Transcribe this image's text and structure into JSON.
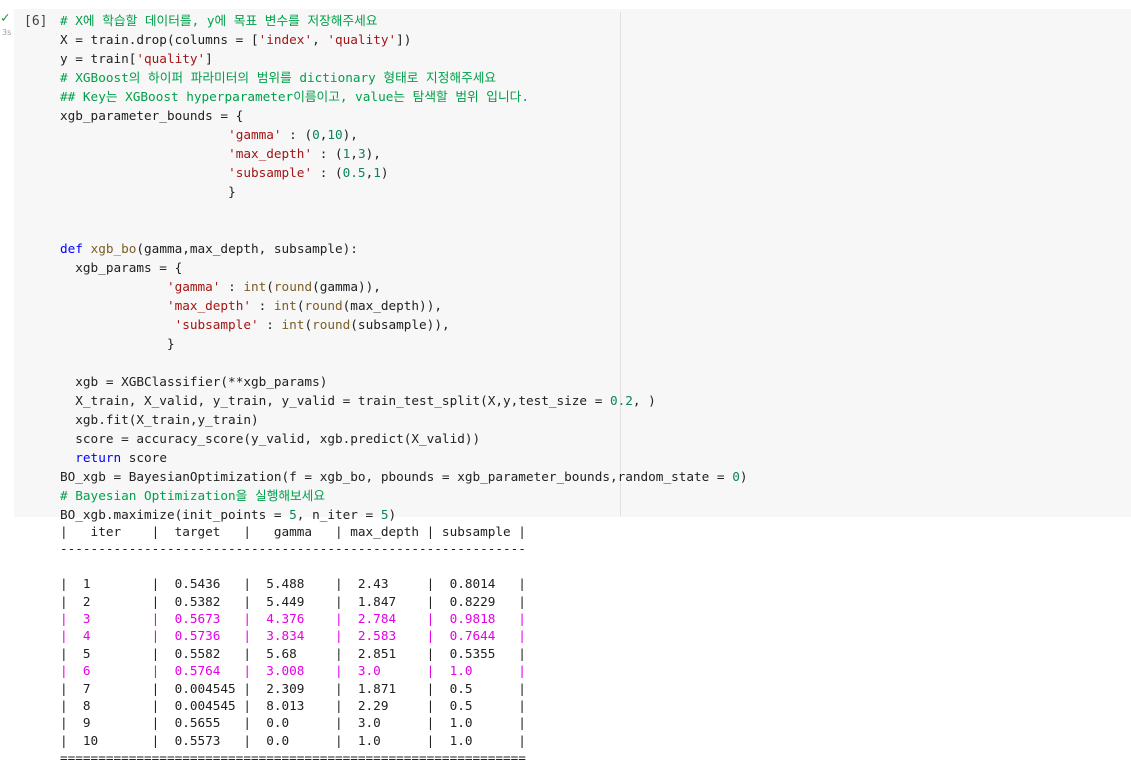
{
  "cell": {
    "execution_count": "[6]",
    "exec_time": "3s",
    "status_icon": "check-icon"
  },
  "code": {
    "line1_comment": "# X에 학습할 데이터를, y에 목표 변수를 저장해주세요",
    "line2_a": "X = train.drop(columns = [",
    "line2_s1": "'index'",
    "line2_b": ", ",
    "line2_s2": "'quality'",
    "line2_c": "])",
    "line3_a": "y = train[",
    "line3_s": "'quality'",
    "line3_b": "]",
    "line4_comment": "# XGBoost의 하이퍼 파라미터의 범위를 dictionary 형태로 지정해주세요",
    "line5_comment": "## Key는 XGBoost hyperparameter이름이고, value는 탐색할 범위 입니다.",
    "line6": "xgb_parameter_bounds = {",
    "line7_s": "'gamma'",
    "line7_a": " : (",
    "line7_n1": "0",
    "line7_b": ",",
    "line7_n2": "10",
    "line7_c": "),",
    "line8_s": "'max_depth'",
    "line8_a": " : (",
    "line8_n1": "1",
    "line8_b": ",",
    "line8_n2": "3",
    "line8_c": "),",
    "line9_s": "'subsample'",
    "line9_a": " : (",
    "line9_n1": "0.5",
    "line9_b": ",",
    "line9_n2": "1",
    "line9_c": ")",
    "line10": "}",
    "line12_k": "def",
    "line12_f": "xgb_bo",
    "line12_a": "(gamma,max_depth, subsample):",
    "line13": "xgb_params = {",
    "line14_s": "'gamma'",
    "line14_a": " : ",
    "line14_f1": "int",
    "line14_b": "(",
    "line14_f2": "round",
    "line14_c": "(gamma)),",
    "line15_s": "'max_depth'",
    "line15_a": " : ",
    "line15_f1": "int",
    "line15_b": "(",
    "line15_f2": "round",
    "line15_c": "(max_depth)),",
    "line16_s": "'subsample'",
    "line16_a": " : ",
    "line16_f1": "int",
    "line16_b": "(",
    "line16_f2": "round",
    "line16_c": "(subsample)),",
    "line17": "}",
    "line19": "xgb = XGBClassifier(**xgb_params)",
    "line20_a": "X_train, X_valid, y_train, y_valid = train_test_split(X,y,test_size = ",
    "line20_n": "0.2",
    "line20_b": ", )",
    "line21": "xgb.fit(X_train,y_train)",
    "line22": "score = accuracy_score(y_valid, xgb.predict(X_valid))",
    "line23_k": "return",
    "line23_a": " score",
    "line24_a": "BO_xgb = BayesianOptimization(f = xgb_bo, pbounds = xgb_parameter_bounds,random_state = ",
    "line24_n": "0",
    "line24_b": ")",
    "line25_comment": "# Bayesian Optimization을 실행해보세요",
    "line26_a": "BO_xgb.maximize(init_points = ",
    "line26_n1": "5",
    "line26_b": ", n_iter = ",
    "line26_n2": "5",
    "line26_c": ")"
  },
  "output": {
    "header": "|   iter    |  target   |   gamma   | max_depth | subsample |",
    "separator": "-------------------------------------------------------------",
    "rows": [
      {
        "text": "|  1        |  0.5436   |  5.488    |  2.43     |  0.8014   |",
        "highlight": false
      },
      {
        "text": "|  2        |  0.5382   |  5.449    |  1.847    |  0.8229   |",
        "highlight": false
      },
      {
        "text": "|  3        |  0.5673   |  4.376    |  2.784    |  0.9818   |",
        "highlight": true
      },
      {
        "text": "|  4        |  0.5736   |  3.834    |  2.583    |  0.7644   |",
        "highlight": true
      },
      {
        "text": "|  5        |  0.5582   |  5.68     |  2.851    |  0.5355   |",
        "highlight": false
      },
      {
        "text": "|  6        |  0.5764   |  3.008    |  3.0      |  1.0      |",
        "highlight": true
      },
      {
        "text": "|  7        |  0.004545 |  2.309    |  1.871    |  0.5      |",
        "highlight": false
      },
      {
        "text": "|  8        |  0.004545 |  8.013    |  2.29     |  0.5      |",
        "highlight": false
      },
      {
        "text": "|  9        |  0.5655   |  0.0      |  3.0      |  1.0      |",
        "highlight": false
      },
      {
        "text": "|  10       |  0.5573   |  0.0      |  1.0      |  1.0      |",
        "highlight": false
      }
    ],
    "footer": "============================================================="
  }
}
